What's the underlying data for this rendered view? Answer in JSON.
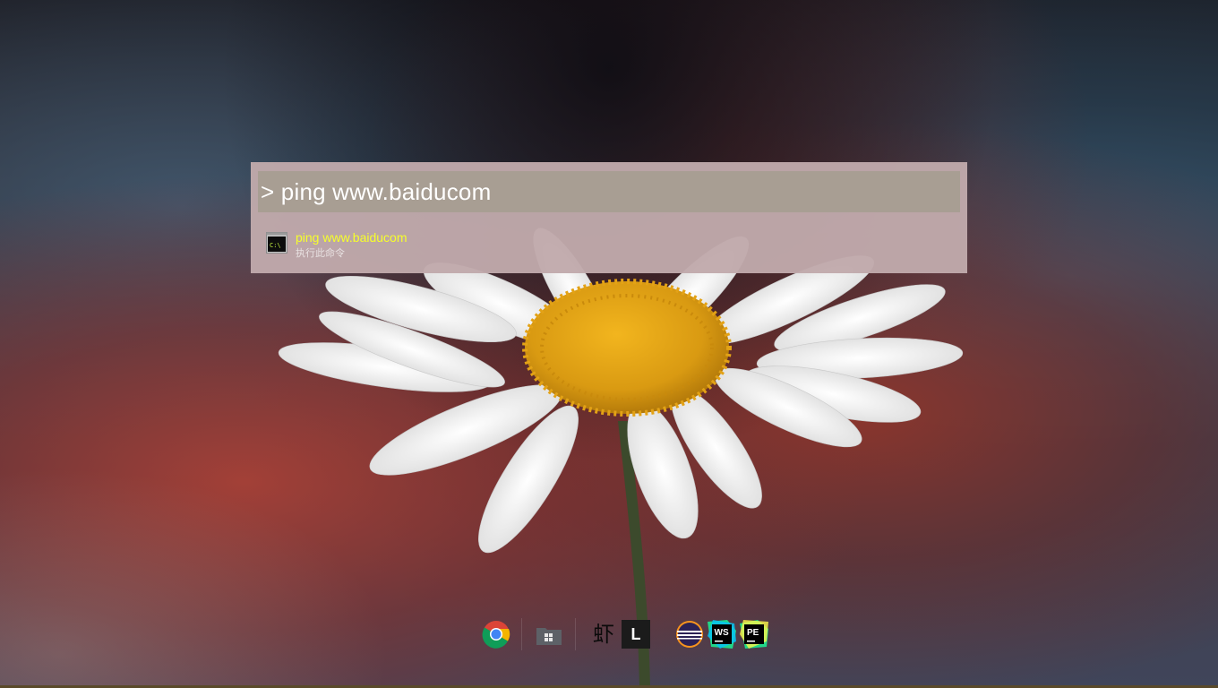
{
  "launcher": {
    "query": "> ping www.baiducom",
    "results": [
      {
        "title": "ping www.baiducom",
        "subtitle": "执行此命令",
        "icon": "cmd-icon",
        "icon_label": "C:\\"
      }
    ]
  },
  "dock": {
    "items": [
      {
        "name": "chrome-icon"
      },
      {
        "name": "file-explorer-icon"
      },
      {
        "name": "xiami-icon",
        "label": "虾"
      },
      {
        "name": "l-app-icon",
        "label": "L"
      },
      {
        "name": "eclipse-icon"
      },
      {
        "name": "webstorm-icon",
        "label": "WS"
      },
      {
        "name": "pycharm-edu-icon",
        "label": "PE"
      }
    ]
  },
  "colors": {
    "launcher_bg": "#c1aaac",
    "query_bg": "#a89e93",
    "result_title": "#f6ff2a",
    "result_sub": "#e8e1e1"
  }
}
